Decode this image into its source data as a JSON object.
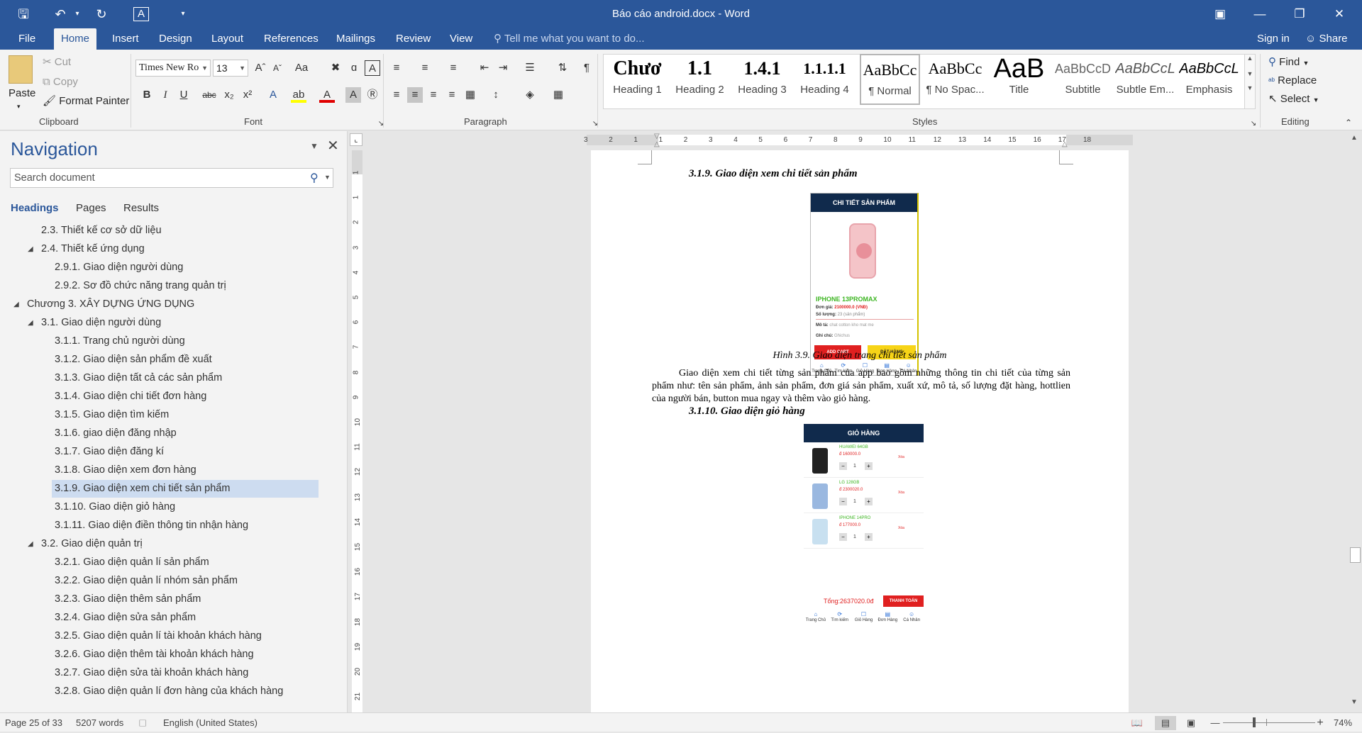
{
  "titlebar": {
    "title": "Báo cáo android.docx - Word"
  },
  "tabs": [
    "File",
    "Home",
    "Insert",
    "Design",
    "Layout",
    "References",
    "Mailings",
    "Review",
    "View"
  ],
  "tell_me": "Tell me what you want to do...",
  "sign_in": "Sign in",
  "share": "Share",
  "clipboard": {
    "paste": "Paste",
    "cut": "Cut",
    "copy": "Copy",
    "format_painter": "Format Painter",
    "label": "Clipboard"
  },
  "font": {
    "name": "Times New Ro",
    "size": "13",
    "label": "Font"
  },
  "paragraph": {
    "label": "Paragraph"
  },
  "styles": {
    "label": "Styles",
    "items": [
      {
        "preview": "Chươ",
        "name": "Heading 1"
      },
      {
        "preview": "1.1",
        "name": "Heading 2"
      },
      {
        "preview": "1.4.1",
        "name": "Heading 3"
      },
      {
        "preview": "1.1.1.1",
        "name": "Heading 4"
      },
      {
        "preview": "AaBbCc",
        "name": "¶ Normal"
      },
      {
        "preview": "AaBbCc",
        "name": "¶ No Spac..."
      },
      {
        "preview": "AaB",
        "name": "Title"
      },
      {
        "preview": "AaBbCcD",
        "name": "Subtitle"
      },
      {
        "preview": "AaBbCcL",
        "name": "Subtle Em..."
      },
      {
        "preview": "AaBbCcL",
        "name": "Emphasis"
      }
    ]
  },
  "editing": {
    "find": "Find",
    "replace": "Replace",
    "select": "Select",
    "label": "Editing"
  },
  "navigation": {
    "title": "Navigation",
    "search_placeholder": "Search document",
    "tabs": [
      "Headings",
      "Pages",
      "Results"
    ],
    "items": [
      {
        "text": "2.3. Thiết kế cơ sở dữ liệu",
        "level": 2,
        "expand": false
      },
      {
        "text": "2.4. Thiết kế ứng dụng",
        "level": 2,
        "expand": true
      },
      {
        "text": "2.9.1. Giao diện người dùng",
        "level": 3,
        "expand": false
      },
      {
        "text": "2.9.2. Sơ đồ chức năng trang quản trị",
        "level": 3,
        "expand": false
      },
      {
        "text": "Chương 3. XÂY DỰNG ỨNG DỤNG",
        "level": 1,
        "expand": true
      },
      {
        "text": "3.1. Giao diện người dùng",
        "level": 2,
        "expand": true
      },
      {
        "text": "3.1.1. Trang chủ người dùng",
        "level": 3,
        "expand": false
      },
      {
        "text": "3.1.2. Giao diện sản phẩm đề xuất",
        "level": 3,
        "expand": false
      },
      {
        "text": "3.1.3. Giao diện tất cả các sản phẩm",
        "level": 3,
        "expand": false
      },
      {
        "text": "3.1.4. Giao diện chi tiết đơn hàng",
        "level": 3,
        "expand": false
      },
      {
        "text": "3.1.5. Giao diện tìm kiếm",
        "level": 3,
        "expand": false
      },
      {
        "text": "3.1.6. giao diện đăng nhập",
        "level": 3,
        "expand": false
      },
      {
        "text": "3.1.7. Giao diện đăng kí",
        "level": 3,
        "expand": false
      },
      {
        "text": "3.1.8. Giao diện xem đơn hàng",
        "level": 3,
        "expand": false
      },
      {
        "text": "3.1.9. Giao diện xem chi tiết sản phẩm",
        "level": 3,
        "expand": false,
        "selected": true
      },
      {
        "text": "3.1.10. Giao diện giỏ hàng",
        "level": 3,
        "expand": false
      },
      {
        "text": "3.1.11. Giao diện điền thông tin nhận hàng",
        "level": 3,
        "expand": false
      },
      {
        "text": "3.2. Giao diện quản trị",
        "level": 2,
        "expand": true
      },
      {
        "text": "3.2.1. Giao diện quản lí sản phẩm",
        "level": 3,
        "expand": false
      },
      {
        "text": "3.2.2. Giao diện quản lí nhóm sản phẩm",
        "level": 3,
        "expand": false
      },
      {
        "text": "3.2.3. Giao diện thêm sản phẩm",
        "level": 3,
        "expand": false
      },
      {
        "text": "3.2.4. Giao diện sửa sản phẩm",
        "level": 3,
        "expand": false
      },
      {
        "text": "3.2.5. Giao diện quản lí tài khoản khách hàng",
        "level": 3,
        "expand": false
      },
      {
        "text": "3.2.6. Giao diện thêm tài khoản khách hàng",
        "level": 3,
        "expand": false
      },
      {
        "text": "3.2.7. Giao diện sửa tài khoản khách hàng",
        "level": 3,
        "expand": false
      },
      {
        "text": "3.2.8. Giao diện quản lí đơn hàng của khách hàng",
        "level": 3,
        "expand": false
      }
    ]
  },
  "ruler": {
    "ticks": [
      "3",
      "2",
      "1",
      "1",
      "2",
      "3",
      "4",
      "5",
      "6",
      "7",
      "8",
      "9",
      "10",
      "11",
      "12",
      "13",
      "14",
      "15",
      "16",
      "17",
      "18"
    ]
  },
  "vruler": {
    "ticks": [
      "1",
      "1",
      "2",
      "3",
      "4",
      "5",
      "6",
      "7",
      "8",
      "9",
      "10",
      "11",
      "12",
      "13",
      "14",
      "15",
      "16",
      "17",
      "18",
      "19",
      "20",
      "21"
    ]
  },
  "document": {
    "heading1": "3.1.9. Giao diện xem chi tiết sản phẩm",
    "caption1": "Hình 3.9. Giao diện trang chi tiết sản phẩm",
    "para1": "Giao diện xem chi tiết từng sản phẩm của app bao gồm những thông tin chi tiết của từng sản phẩm như: tên sản phẩm, ảnh sản phẩm, đơn giá sản phẩm, xuất xứ, mô tả, số lượng đặt hàng, hottlien của người bán, button mua ngay và thêm vào giỏ hàng.",
    "heading2": "3.1.10. Giao diện giỏ hàng",
    "phone1": {
      "title": "CHI TIẾT SẢN PHẨM",
      "product": "IPHONE 13PROMAX",
      "price_label": "Đơn giá:",
      "price": "2100000.0",
      "currency": "(VNĐ)",
      "qty_label": "Số lượng:",
      "qty": "23",
      "qty_note": "(sản phẩm)",
      "desc_label": "Mô tả:",
      "desc": "chat cotton kho mat me",
      "note_label": "Ghi chú:",
      "note": "Ghichus",
      "add_cart": "ADD CART",
      "order": "ĐẶT HÀNG",
      "footer": [
        "Trang Chủ",
        "Tìm kiếm",
        "Giỏ Hàng",
        "Đơn Hàng",
        "Cá Nhân"
      ]
    },
    "phone2": {
      "title": "GIỎ HÀNG",
      "items": [
        {
          "name": "HUAWEI 64GB",
          "price": "đ 160000.0",
          "qty": "1",
          "del": "Xóa"
        },
        {
          "name": "LG 128GB",
          "price": "đ 2300020.0",
          "qty": "1",
          "del": "Xóa"
        },
        {
          "name": "IPHONE 14PRO",
          "price": "đ 177000.0",
          "qty": "1",
          "del": "Xóa"
        }
      ],
      "total": "Tổng:2637020.0đ",
      "checkout": "THANH TOÁN",
      "footer": [
        "Trang Chủ",
        "Tìm kiếm",
        "Giỏ Hàng",
        "Đơn Hàng",
        "Cá Nhân"
      ]
    }
  },
  "status": {
    "page": "Page 25 of 33",
    "words": "5207 words",
    "language": "English (United States)",
    "zoom": "74%"
  },
  "colors": {
    "word_blue": "#2b579a",
    "nav_highlight": "#cddcf0",
    "phone_bar": "#102a4c",
    "product_green": "#3cb521",
    "price_red": "#e02020",
    "order_yellow": "#f7d417"
  }
}
